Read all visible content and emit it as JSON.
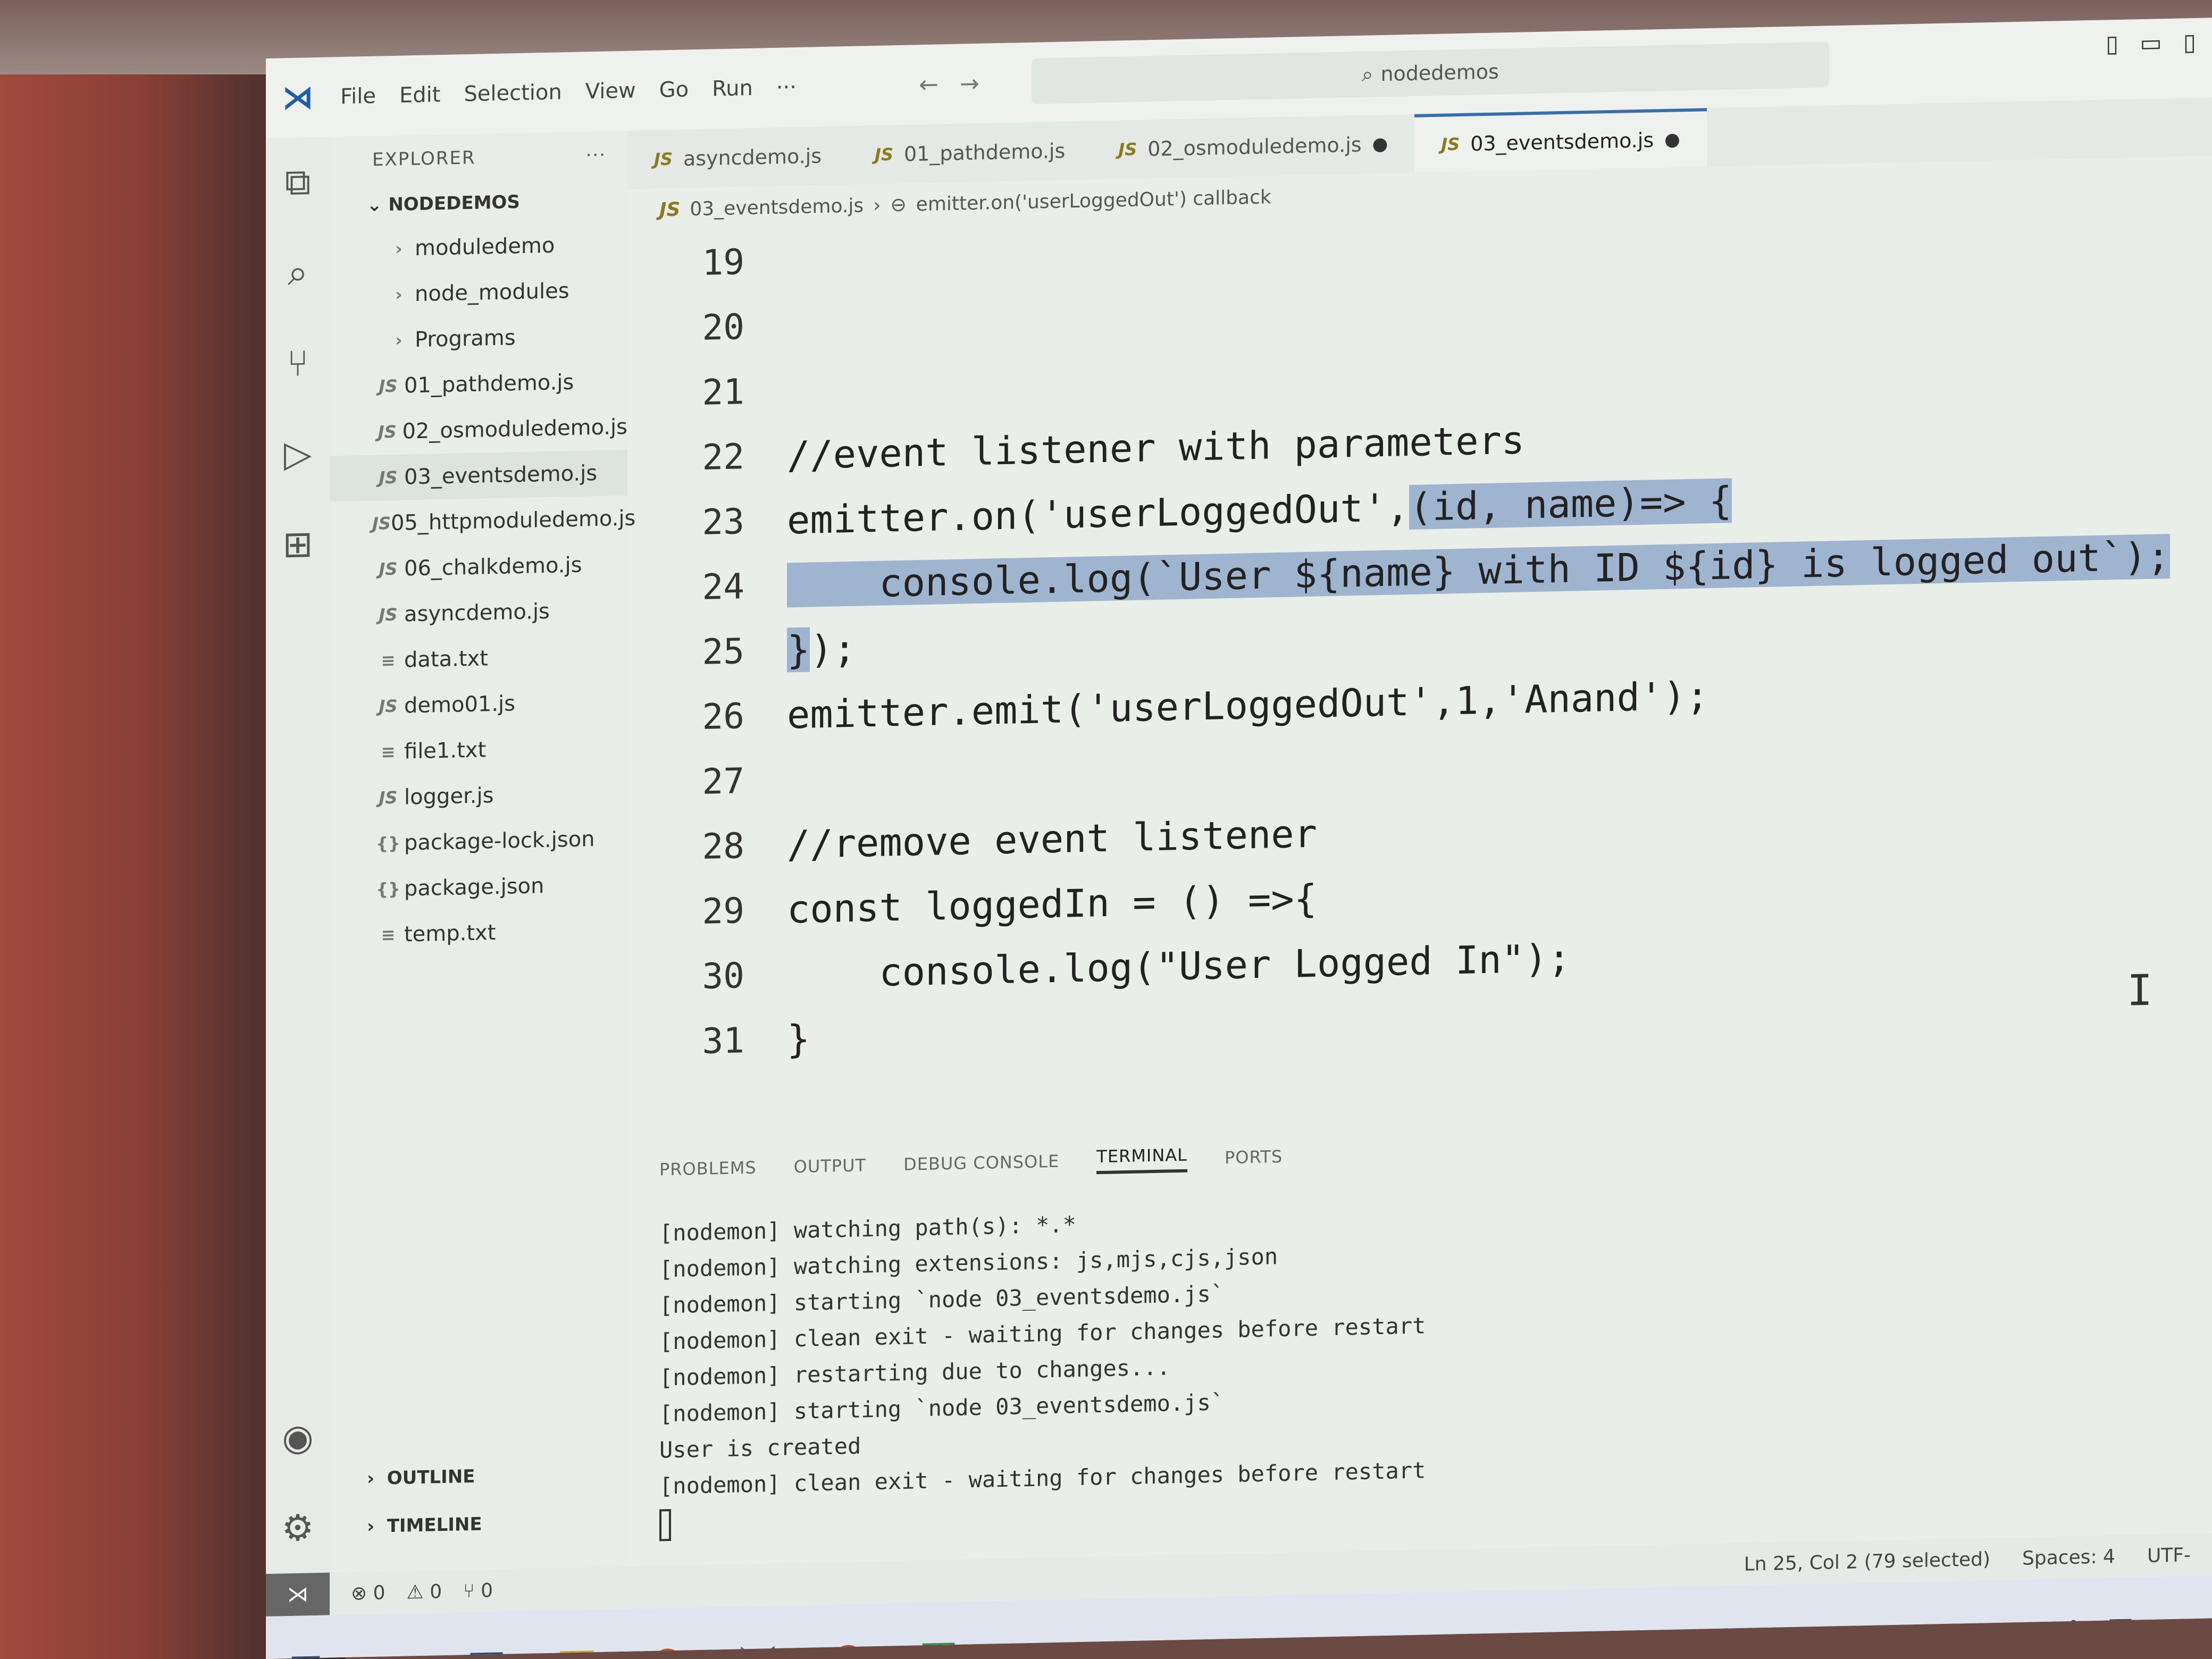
{
  "window": {
    "menu": [
      "File",
      "Edit",
      "Selection",
      "View",
      "Go",
      "Run",
      "···"
    ],
    "search_text": "nodedemos",
    "back_arrow": "←",
    "forward_arrow": "→"
  },
  "sidebar": {
    "title": "EXPLORER",
    "more": "···",
    "folder": "NODEDEMOS",
    "items": [
      {
        "label": "moduledemo",
        "type": "folder"
      },
      {
        "label": "node_modules",
        "type": "folder"
      },
      {
        "label": "Programs",
        "type": "folder"
      },
      {
        "label": "01_pathdemo.js",
        "type": "js"
      },
      {
        "label": "02_osmoduledemo.js",
        "type": "js"
      },
      {
        "label": "03_eventsdemo.js",
        "type": "js",
        "selected": true
      },
      {
        "label": "05_httpmoduledemo.js",
        "type": "js"
      },
      {
        "label": "06_chalkdemo.js",
        "type": "js"
      },
      {
        "label": "asyncdemo.js",
        "type": "js"
      },
      {
        "label": "data.txt",
        "type": "txt"
      },
      {
        "label": "demo01.js",
        "type": "js"
      },
      {
        "label": "file1.txt",
        "type": "txt"
      },
      {
        "label": "logger.js",
        "type": "js"
      },
      {
        "label": "package-lock.json",
        "type": "json"
      },
      {
        "label": "package.json",
        "type": "json"
      },
      {
        "label": "temp.txt",
        "type": "txt"
      }
    ],
    "outline": "OUTLINE",
    "timeline": "TIMELINE"
  },
  "tabs": [
    {
      "label": "asyncdemo.js",
      "modified": false,
      "active": false
    },
    {
      "label": "01_pathdemo.js",
      "modified": false,
      "active": false
    },
    {
      "label": "02_osmoduledemo.js",
      "modified": true,
      "active": false
    },
    {
      "label": "03_eventsdemo.js",
      "modified": true,
      "active": true
    }
  ],
  "breadcrumb": [
    "03_eventsdemo.js",
    "emitter.on('userLoggedOut') callback"
  ],
  "editor": {
    "lines": [
      {
        "n": "19",
        "code": ""
      },
      {
        "n": "20",
        "code": ""
      },
      {
        "n": "21",
        "code": ""
      },
      {
        "n": "22",
        "code": "//event listener with parameters"
      },
      {
        "n": "23",
        "code": "emitter.on('userLoggedOut',",
        "selected": "(id, name)=> {"
      },
      {
        "n": "24",
        "code": "",
        "selected": "    console.log(`User ${name} with ID ${id} is logged out`);"
      },
      {
        "n": "25",
        "code": ");",
        "selected": "}"
      },
      {
        "n": "26",
        "code": "emitter.emit('userLoggedOut',1,'Anand');"
      },
      {
        "n": "27",
        "code": ""
      },
      {
        "n": "28",
        "code": "//remove event listener"
      },
      {
        "n": "29",
        "code": "const loggedIn = () =>{"
      },
      {
        "n": "30",
        "code": "    console.log(\"User Logged In\");"
      },
      {
        "n": "31",
        "code": "}"
      }
    ]
  },
  "panel": {
    "tabs": [
      "PROBLEMS",
      "OUTPUT",
      "DEBUG CONSOLE",
      "TERMINAL",
      "PORTS"
    ],
    "active_tab": "TERMINAL",
    "terminal_lines": [
      "[nodemon] watching path(s): *.*",
      "[nodemon] watching extensions: js,mjs,cjs,json",
      "[nodemon] starting `node 03_eventsdemo.js`",
      "[nodemon] clean exit - waiting for changes before restart",
      "[nodemon] restarting due to changes...",
      "[nodemon] starting `node 03_eventsdemo.js`",
      "User is created",
      "[nodemon] clean exit - waiting for changes before restart"
    ]
  },
  "statusbar": {
    "errors": "⊗ 0",
    "warnings": "⚠ 0",
    "ports": "⑂ 0",
    "position": "Ln 25, Col 2 (79 selected)",
    "spaces": "Spaces: 4",
    "encoding": "UTF-"
  },
  "colors": {
    "selection": "#9fb4cf",
    "accent": "#3a6ea8"
  }
}
